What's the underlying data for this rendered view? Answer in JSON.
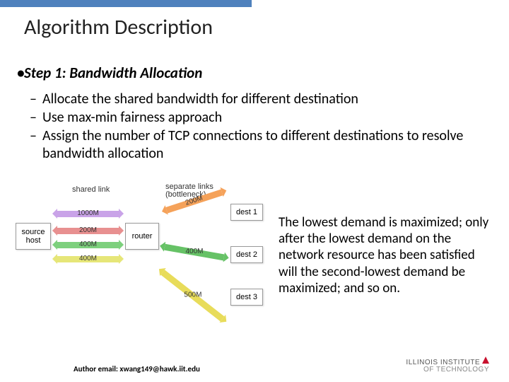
{
  "title": "Algorithm Description",
  "step": "Step 1: Bandwidth Allocation",
  "bullets": [
    "Allocate the shared bandwidth for different destination",
    "Use max-min fairness approach",
    "Assign the number of TCP connections to different destinations to resolve bandwidth allocation"
  ],
  "diagram": {
    "shared_label": "shared link",
    "separate_label": "separate links\n(bottleneck)",
    "source": "source\nhost",
    "router": "router",
    "dests": [
      "dest 1",
      "dest 2",
      "dest 3"
    ],
    "shared_arrows": [
      "1000M",
      "200M",
      "400M",
      "400M"
    ],
    "bottleneck_arrows": [
      "200M",
      "400M",
      "500M"
    ]
  },
  "desc": "The lowest demand is maximized; only after the lowest demand on the network resource has been satisfied will the second-lowest demand be maximized; and so on.",
  "footer": "Author email: xwang149@hawk.iit.edu",
  "logo": {
    "l1": "ILLINOIS INSTITUTE",
    "l2": "OF TECHNOLOGY"
  }
}
